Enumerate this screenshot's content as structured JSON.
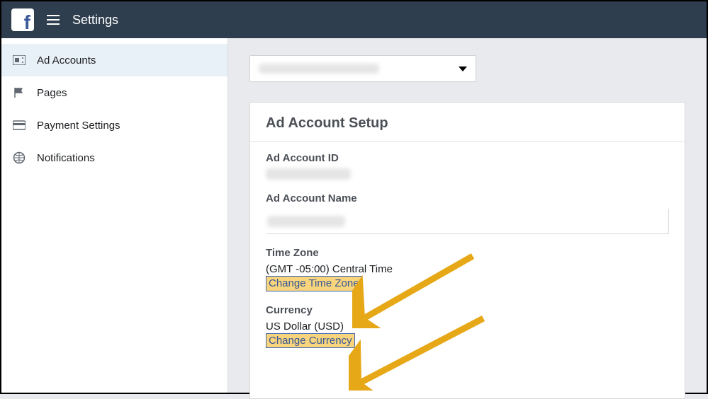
{
  "header": {
    "title": "Settings"
  },
  "sidebar": {
    "items": [
      {
        "label": "Ad Accounts"
      },
      {
        "label": "Pages"
      },
      {
        "label": "Payment Settings"
      },
      {
        "label": "Notifications"
      }
    ]
  },
  "main": {
    "card_title": "Ad Account Setup",
    "sections": {
      "id_label": "Ad Account ID",
      "name_label": "Ad Account Name",
      "tz_label": "Time Zone",
      "tz_value": "(GMT -05:00) Central Time",
      "tz_link": "Change Time Zone",
      "currency_label": "Currency",
      "currency_value": "US Dollar (USD)",
      "currency_link": "Change Currency"
    }
  }
}
